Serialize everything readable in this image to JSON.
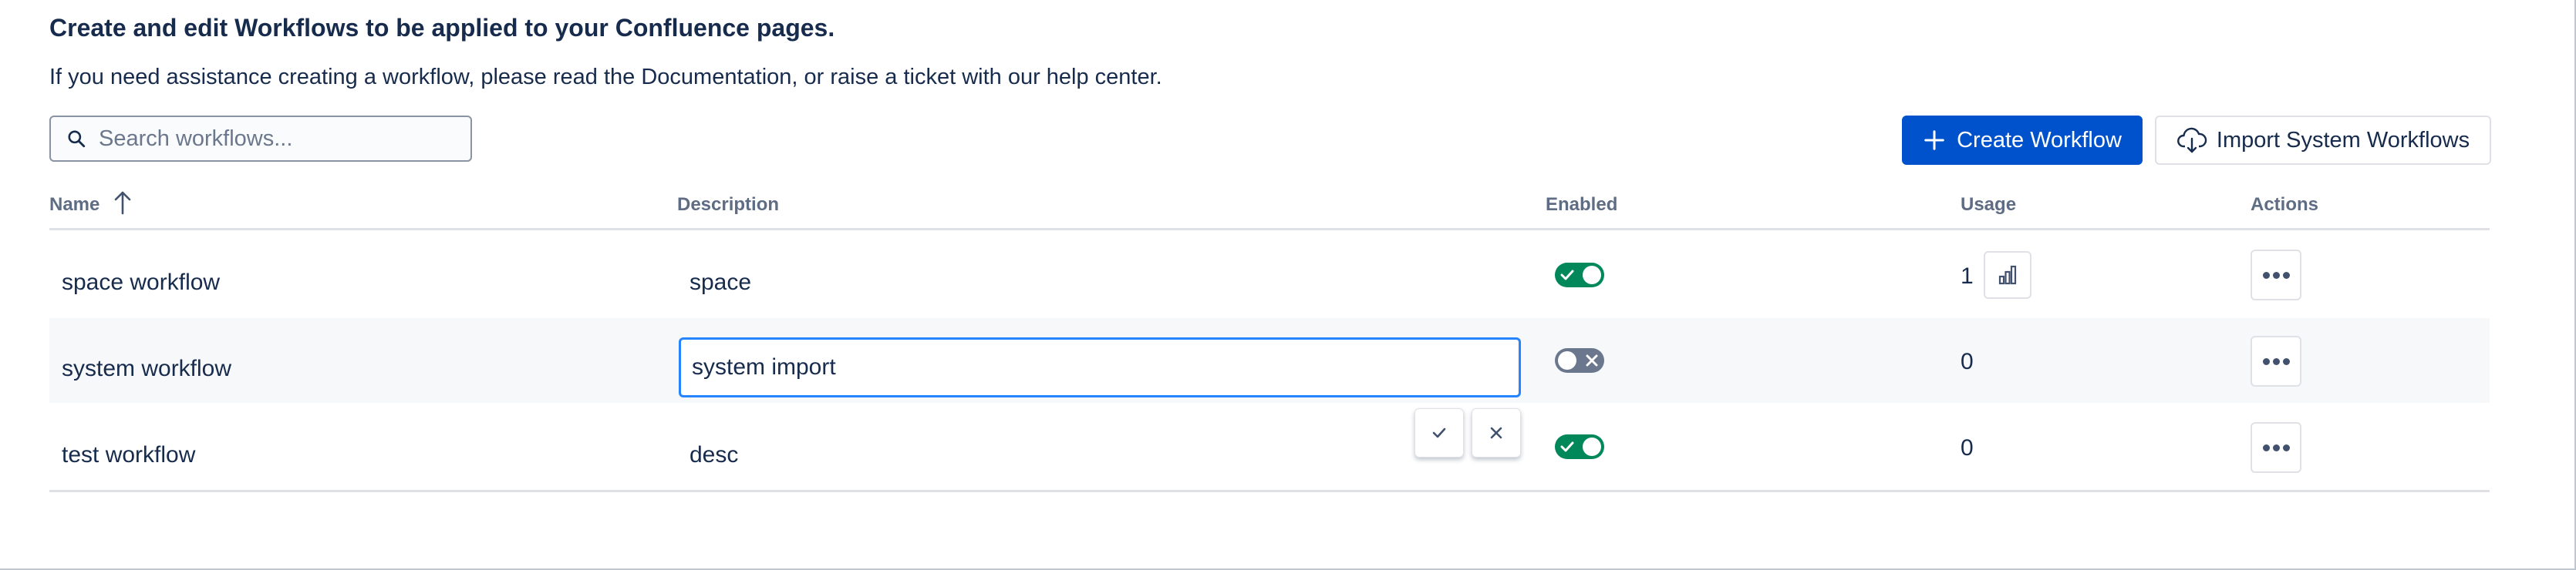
{
  "page": {
    "heading": "Create and edit Workflows to be applied to your Confluence pages.",
    "subtext": "If you need assistance creating a workflow, please read the Documentation, or raise a ticket with our help center."
  },
  "toolbar": {
    "search_placeholder": "Search workflows...",
    "search_value": "",
    "create_label": "Create Workflow",
    "import_label": "Import System Workflows"
  },
  "table": {
    "columns": {
      "name": "Name",
      "description": "Description",
      "enabled": "Enabled",
      "usage": "Usage",
      "actions": "Actions"
    },
    "sort": {
      "column": "Name",
      "direction": "ascending"
    },
    "rows": [
      {
        "name": "space workflow",
        "description": "space",
        "enabled": true,
        "usage": "1"
      },
      {
        "name": "system workflow",
        "description": "system import",
        "enabled": false,
        "usage": "0",
        "editing": true
      },
      {
        "name": "test workflow",
        "description": "desc",
        "enabled": true,
        "usage": "0"
      }
    ]
  },
  "colors": {
    "primary": "#0052cc",
    "enabled_on": "#00875a",
    "enabled_off": "#6b778c",
    "focus": "#2684ff"
  },
  "icons": {
    "search": "search-icon",
    "sort": "arrow-up-icon",
    "create": "plus-icon",
    "import": "cloud-download-icon",
    "usage": "bar-chart-icon",
    "actions": "more-horizontal-icon",
    "confirm": "check-icon",
    "cancel": "close-icon"
  }
}
